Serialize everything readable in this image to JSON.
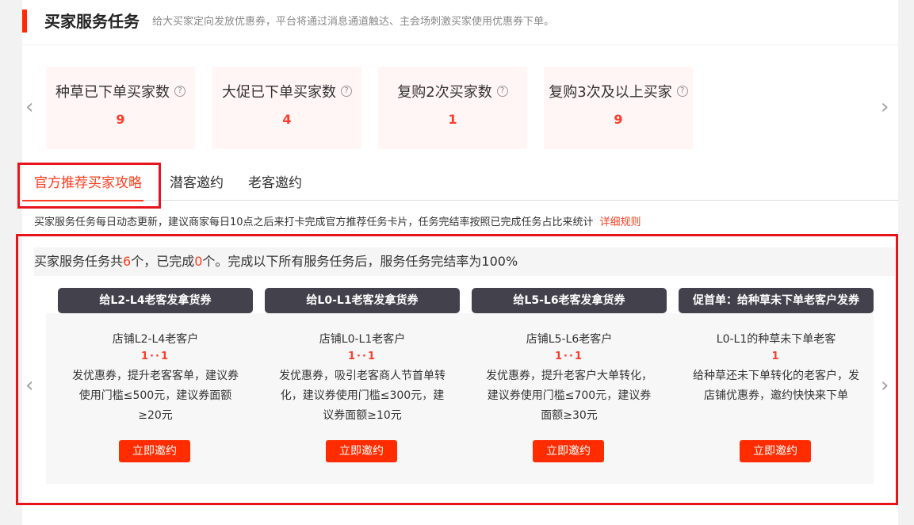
{
  "header": {
    "title": "买家服务任务",
    "description": "给大买家定向发放优惠券，平台将通过消息通道触达、主会场刺激买家使用优惠券下单。"
  },
  "stats": [
    {
      "label": "种草已下单买家数",
      "value": "9"
    },
    {
      "label": "大促已下单买家数",
      "value": "4"
    },
    {
      "label": "复购2次买家数",
      "value": "1"
    },
    {
      "label": "复购3次及以上买家",
      "value": "9"
    }
  ],
  "icons": {
    "help": "question-circle-icon",
    "prev": "chevron-left-icon",
    "next": "chevron-right-icon",
    "help_glyph": "?",
    "prev_glyph": "‹",
    "next_glyph": "›"
  },
  "tabs": [
    {
      "label": "官方推荐买家攻略",
      "active": true
    },
    {
      "label": "潜客邀约",
      "active": false
    },
    {
      "label": "老客邀约",
      "active": false
    }
  ],
  "notice": {
    "text": "买家服务任务每日动态更新，建议商家每日10点之后来打卡完成官方推荐任务卡片，任务完结率按照已完成任务占比来统计",
    "link": "详细规则"
  },
  "summary": {
    "prefix": "买家服务任务共",
    "total": "6",
    "mid": "个，已完成",
    "done": "0",
    "suffix": "个。完成以下所有服务任务后，服务任务完结率为100%"
  },
  "tasks": [
    {
      "tag": "给L2-L4老客发拿货券",
      "target": "店铺L2-L4老客户",
      "count": "1··1",
      "desc": "发优惠券，提升老客客单，建议券使用门槛≤500元，建议券面额≥20元",
      "button": "立即邀约"
    },
    {
      "tag": "给L0-L1老客发拿货券",
      "target": "店铺L0-L1老客户",
      "count": "1··1",
      "desc": "发优惠券，吸引老客商人节首单转化，建议券使用门槛≤300元，建议券面额≥10元",
      "button": "立即邀约"
    },
    {
      "tag": "给L5-L6老客发拿货券",
      "target": "店铺L5-L6老客户",
      "count": "1··1",
      "desc": "发优惠券，提升老客户大单转化，建议券使用门槛≤700元，建议券面额≥30元",
      "button": "立即邀约"
    },
    {
      "tag": "促首单：给种草未下单老客户发券",
      "target": "L0-L1的种草未下单老客",
      "count": "1",
      "desc": "给种草还未下单转化的老客户，发店铺优惠券，邀约快快来下单",
      "button": "立即邀约"
    }
  ],
  "colors": {
    "accent": "#ff3c1f",
    "button": "#ff2c00",
    "tag_bg": "#43414b",
    "highlight_box": "#e8141b",
    "stat_bg": "#fff6f5"
  }
}
